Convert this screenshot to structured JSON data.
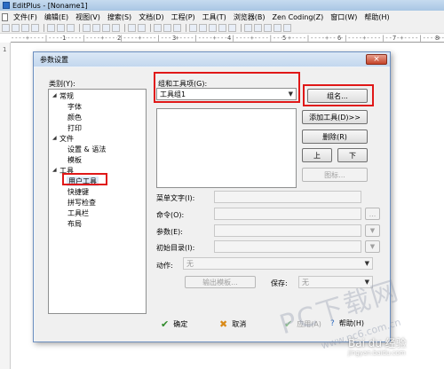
{
  "window": {
    "title": "EditPlus - [Noname1]"
  },
  "menu": [
    "文件(F)",
    "编辑(E)",
    "视图(V)",
    "搜索(S)",
    "文档(D)",
    "工程(P)",
    "工具(T)",
    "浏览器(B)",
    "Zen Coding(Z)",
    "窗口(W)",
    "帮助(H)"
  ],
  "ruler": {
    "marks": [
      "1",
      "2",
      "3",
      "4",
      "5",
      "6",
      "7",
      "8"
    ]
  },
  "editor": {
    "line_number": "1"
  },
  "dialog": {
    "title": "参数设置",
    "close_symbol": "×",
    "category_label": "类别(Y):",
    "tree": {
      "general": "常规",
      "font": "字体",
      "color": "颜色",
      "print": "打印",
      "file": "文件",
      "settings_syntax": "设置 & 语法",
      "template": "模板",
      "tools": "工具",
      "user_tools": "用户工具",
      "shortcut": "快捷键",
      "spellcheck": "拼写检查",
      "toolbar": "工具栏",
      "layout": "布局"
    },
    "group_label": "组和工具项(G):",
    "group_value": "工具组1",
    "buttons": {
      "group_name": "组名...",
      "add_tool": "添加工具(D)>>",
      "delete": "删除(R)",
      "up": "上",
      "down": "下",
      "icon": "图标..."
    },
    "fields": {
      "menu_text": "菜单文字(I):",
      "command": "命令(O):",
      "argument": "参数(E):",
      "init_dir": "初始目录(I):",
      "action": "动作:",
      "action_value": "无",
      "output_template": "输出模板...",
      "save": "保存:",
      "save_value": "无",
      "browse": "..."
    },
    "footer": {
      "ok": "确定",
      "cancel": "取消",
      "apply": "应用(A)",
      "help": "帮助(H)"
    }
  },
  "watermark": {
    "big": "PC下载网",
    "url": "www.pc6.com.cn",
    "baidu": "Bai du 经验",
    "baidu_url": "jingyan.baidu.com"
  }
}
